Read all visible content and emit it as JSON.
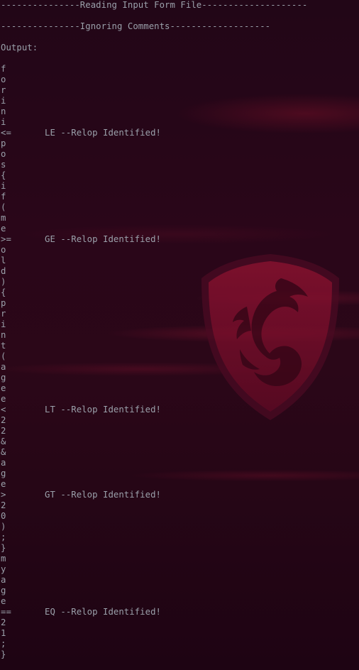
{
  "terminal": {
    "lines": [
      "---------------Reading Input Form File--------------------",
      "",
      "---------------Ignoring Comments-------------------",
      "",
      "Output:",
      "",
      "f",
      "o",
      "r",
      "i",
      "n",
      "i",
      [
        "<=",
        "LE --Relop Identified!"
      ],
      "p",
      "o",
      "s",
      "{",
      "i",
      "f",
      "(",
      "m",
      "e",
      [
        ">=",
        "GE --Relop Identified!"
      ],
      "o",
      "l",
      "d",
      ")",
      "{",
      "p",
      "r",
      "i",
      "n",
      "t",
      "(",
      "a",
      "g",
      "e",
      "e",
      [
        "<",
        "LT --Relop Identified!"
      ],
      "2",
      "2",
      "&",
      "&",
      "a",
      "g",
      "e",
      [
        ">",
        "GT --Relop Identified!"
      ],
      "2",
      "0",
      ")",
      ";",
      "}",
      "m",
      "y",
      "a",
      "g",
      "e",
      [
        "==",
        "EQ --Relop Identified!"
      ],
      "2",
      "1",
      ";",
      "}"
    ]
  },
  "background": {
    "logo_icon": "msi-dragon-shield-icon",
    "accent_color": "#8b1030",
    "base_color": "#1d0514"
  }
}
